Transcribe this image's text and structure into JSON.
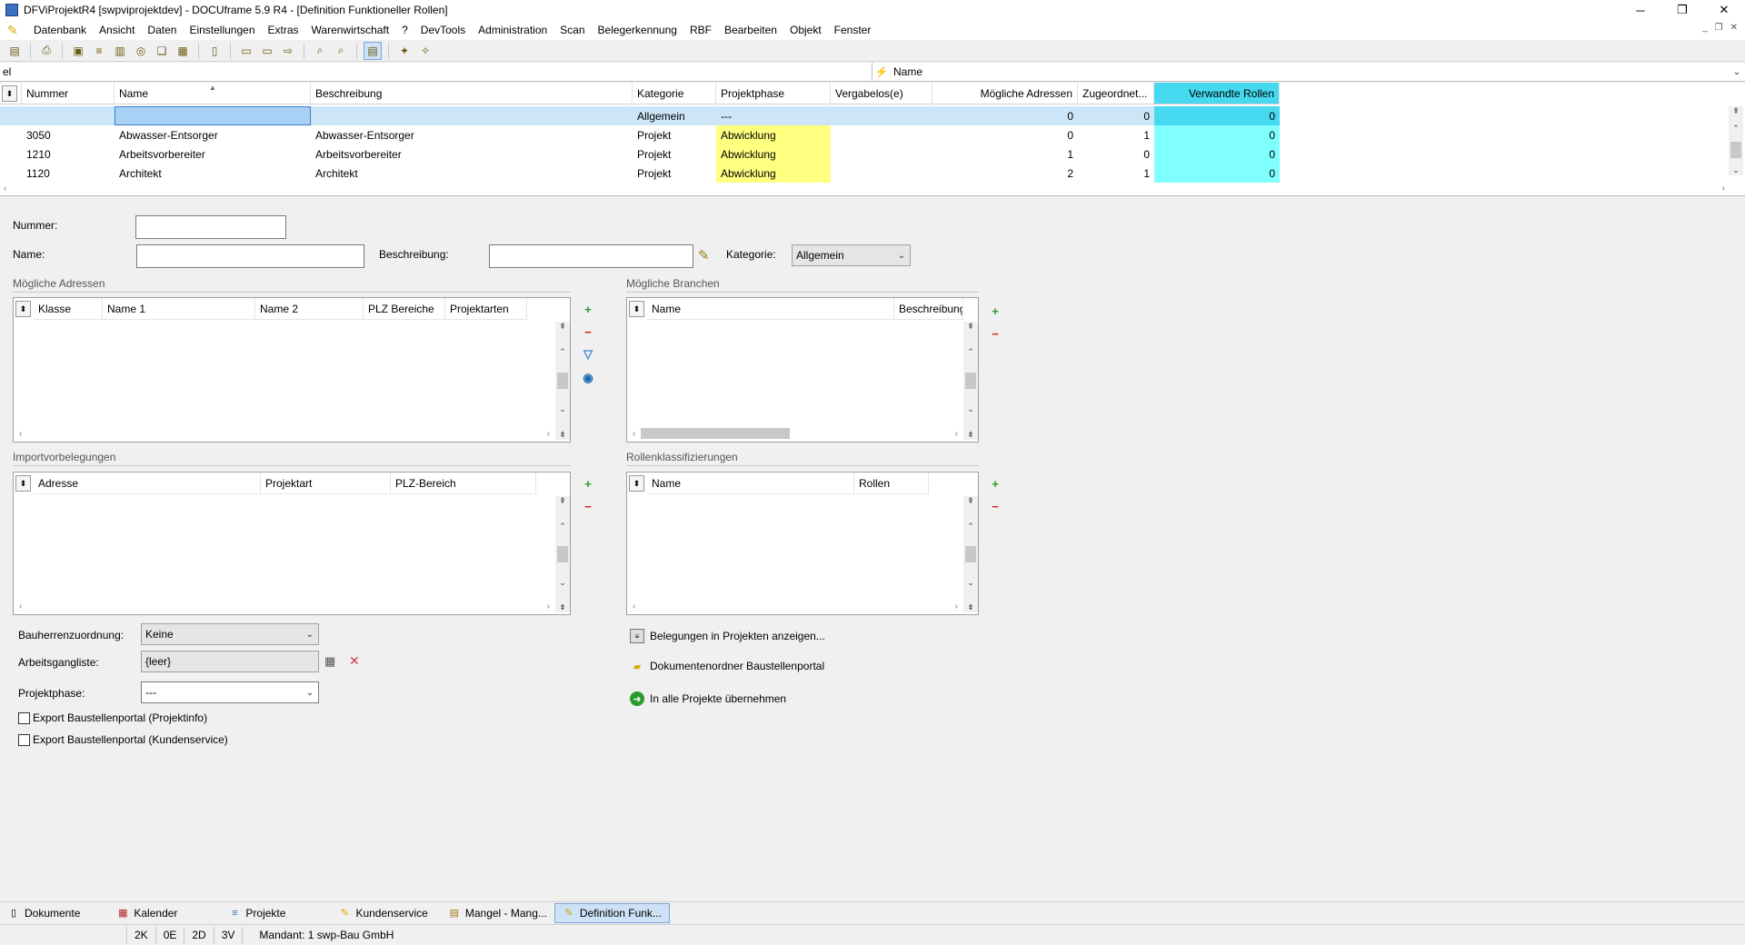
{
  "window": {
    "title": "DFViProjektR4 [swpviprojektdev] - DOCUframe 5.9 R4 - [Definition Funktioneller Rollen]",
    "controls": [
      "─",
      "❐",
      "✕"
    ]
  },
  "menu": [
    "Datenbank",
    "Ansicht",
    "Daten",
    "Einstellungen",
    "Extras",
    "Warenwirtschaft",
    "?",
    "DevTools",
    "Administration",
    "Scan",
    "Belegerkennung",
    "RBF",
    "Bearbeiten",
    "Objekt",
    "Fenster"
  ],
  "search": {
    "value": "el",
    "field_label": "Name"
  },
  "grid": {
    "columns": [
      "Nummer",
      "Name",
      "Beschreibung",
      "Kategorie",
      "Projektphase",
      "Vergabelos(e)",
      "Mögliche Adressen",
      "Zugeordnet...",
      "Verwandte Rollen"
    ],
    "rows": [
      {
        "nummer": "",
        "name": "",
        "beschreibung": "",
        "kategorie": "Allgemein",
        "phase": "---",
        "vergabe": "",
        "adressen": "0",
        "zugeordnet": "0",
        "rollen": "0",
        "selected": true
      },
      {
        "nummer": "3050",
        "name": "Abwasser-Entsorger",
        "beschreibung": "Abwasser-Entsorger",
        "kategorie": "Projekt",
        "phase": "Abwicklung",
        "vergabe": "",
        "adressen": "0",
        "zugeordnet": "1",
        "rollen": "0"
      },
      {
        "nummer": "1210",
        "name": "Arbeitsvorbereiter",
        "beschreibung": "Arbeitsvorbereiter",
        "kategorie": "Projekt",
        "phase": "Abwicklung",
        "vergabe": "",
        "adressen": "1",
        "zugeordnet": "0",
        "rollen": "0"
      },
      {
        "nummer": "1120",
        "name": "Architekt",
        "beschreibung": "Architekt",
        "kategorie": "Projekt",
        "phase": "Abwicklung",
        "vergabe": "",
        "adressen": "2",
        "zugeordnet": "1",
        "rollen": "0"
      }
    ]
  },
  "form": {
    "nummer_label": "Nummer:",
    "nummer_value": "",
    "name_label": "Name:",
    "name_value": "",
    "beschreibung_label": "Beschreibung:",
    "beschreibung_value": "",
    "kategorie_label": "Kategorie:",
    "kategorie_value": "Allgemein"
  },
  "panels": {
    "adressen": {
      "title": "Mögliche Adressen",
      "columns": [
        "Klasse",
        "Name 1",
        "Name 2",
        "PLZ Bereiche",
        "Projektarten"
      ]
    },
    "branchen": {
      "title": "Mögliche Branchen",
      "columns": [
        "Name",
        "Beschreibung"
      ]
    },
    "import": {
      "title": "Importvorbelegungen",
      "columns": [
        "Adresse",
        "Projektart",
        "PLZ-Bereich"
      ]
    },
    "klass": {
      "title": "Rollenklassifizierungen",
      "columns": [
        "Name",
        "Rollen"
      ]
    }
  },
  "lower": {
    "bauherr_label": "Bauherrenzuordnung:",
    "bauherr_value": "Keine",
    "arbeitsgang_label": "Arbeitsgangliste:",
    "arbeitsgang_value": "{leer}",
    "phase_label": "Projektphase:",
    "phase_value": "---",
    "export1": "Export Baustellenportal (Projektinfo)",
    "export2": "Export Baustellenportal (Kundenservice)"
  },
  "actions": [
    "Belegungen in Projekten anzeigen...",
    "Dokumentenordner Baustellenportal",
    "In alle Projekte übernehmen"
  ],
  "tabs": [
    {
      "label": "Dokumente",
      "icon": "documents-icon"
    },
    {
      "label": "Kalender",
      "icon": "calendar-icon"
    },
    {
      "label": "Projekte",
      "icon": "projects-icon"
    },
    {
      "label": "Kundenservice",
      "icon": "service-icon"
    },
    {
      "label": "Mangel - Mang...",
      "icon": "defect-icon"
    },
    {
      "label": "Definition Funk...",
      "icon": "definition-icon",
      "active": true
    }
  ],
  "status": [
    "2K",
    "0E",
    "2D",
    "3V",
    "Mandant: 1 swp-Bau GmbH"
  ],
  "colors": {
    "cyan": "#80ffff",
    "cyan_selected": "#46d9ef",
    "yellow": "#ffff80",
    "selection": "#cde6f7"
  }
}
